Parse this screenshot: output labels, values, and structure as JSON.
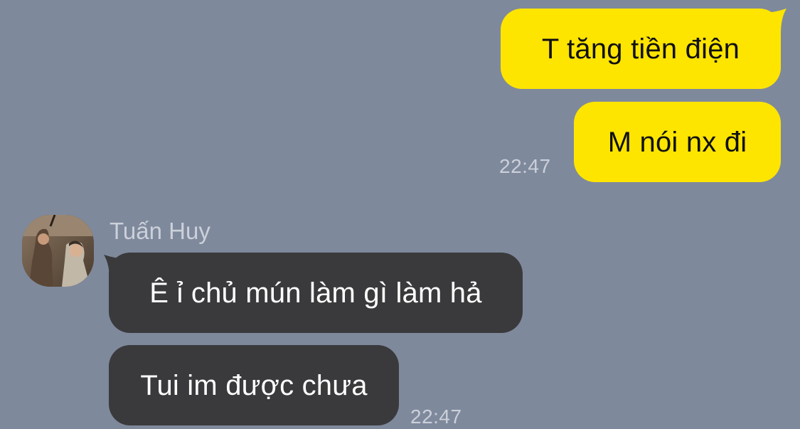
{
  "chat": {
    "outgoing": [
      {
        "text": "T tăng tiền điện"
      },
      {
        "text": "M nói nx đi"
      }
    ],
    "outgoing_time": "22:47",
    "incoming_sender": "Tuấn Huy",
    "incoming": [
      {
        "text": "Ê ỉ chủ mún làm gì làm hả"
      },
      {
        "text": "Tui im được chưa"
      }
    ],
    "incoming_time": "22:47"
  },
  "colors": {
    "background": "#7f899c",
    "outgoing_bubble": "#fee500",
    "incoming_bubble": "#3a3a3c",
    "timestamp": "#cbd0da"
  },
  "icons": {
    "avatar": "profile-photo"
  }
}
